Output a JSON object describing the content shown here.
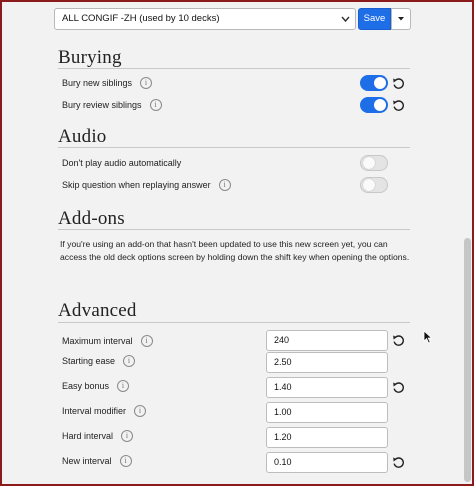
{
  "topbar": {
    "preset": "ALL CONGIF -ZH (used by 10 decks)",
    "save_label": "Save"
  },
  "burying": {
    "title": "Burying",
    "rows": [
      {
        "label": "Bury new siblings",
        "state": "on"
      },
      {
        "label": "Bury review siblings",
        "state": "on"
      }
    ]
  },
  "audio": {
    "title": "Audio",
    "rows": [
      {
        "label": "Don't play audio automatically",
        "state": "off"
      },
      {
        "label": "Skip question when replaying answer",
        "state": "off"
      }
    ]
  },
  "addons": {
    "title": "Add-ons",
    "text": "If you're using an add-on that hasn't been updated to use this new screen yet, you can access the old deck options screen by holding down the shift key when opening the options."
  },
  "advanced": {
    "title": "Advanced",
    "rows": [
      {
        "label": "Maximum interval",
        "value": "240"
      },
      {
        "label": "Starting ease",
        "value": "2.50"
      },
      {
        "label": "Easy bonus",
        "value": "1.40"
      },
      {
        "label": "Interval modifier",
        "value": "1.00"
      },
      {
        "label": "Hard interval",
        "value": "1.20"
      },
      {
        "label": "New interval",
        "value": "0.10"
      }
    ]
  },
  "icons": {
    "info": "info-icon",
    "revert": "revert-icon",
    "chevron": "chevron-down-icon",
    "cursor": "mouse-cursor-icon"
  },
  "colors": {
    "accent": "#1e6ee8",
    "frame": "#8b1a1a",
    "background": "#f2f2f2"
  }
}
